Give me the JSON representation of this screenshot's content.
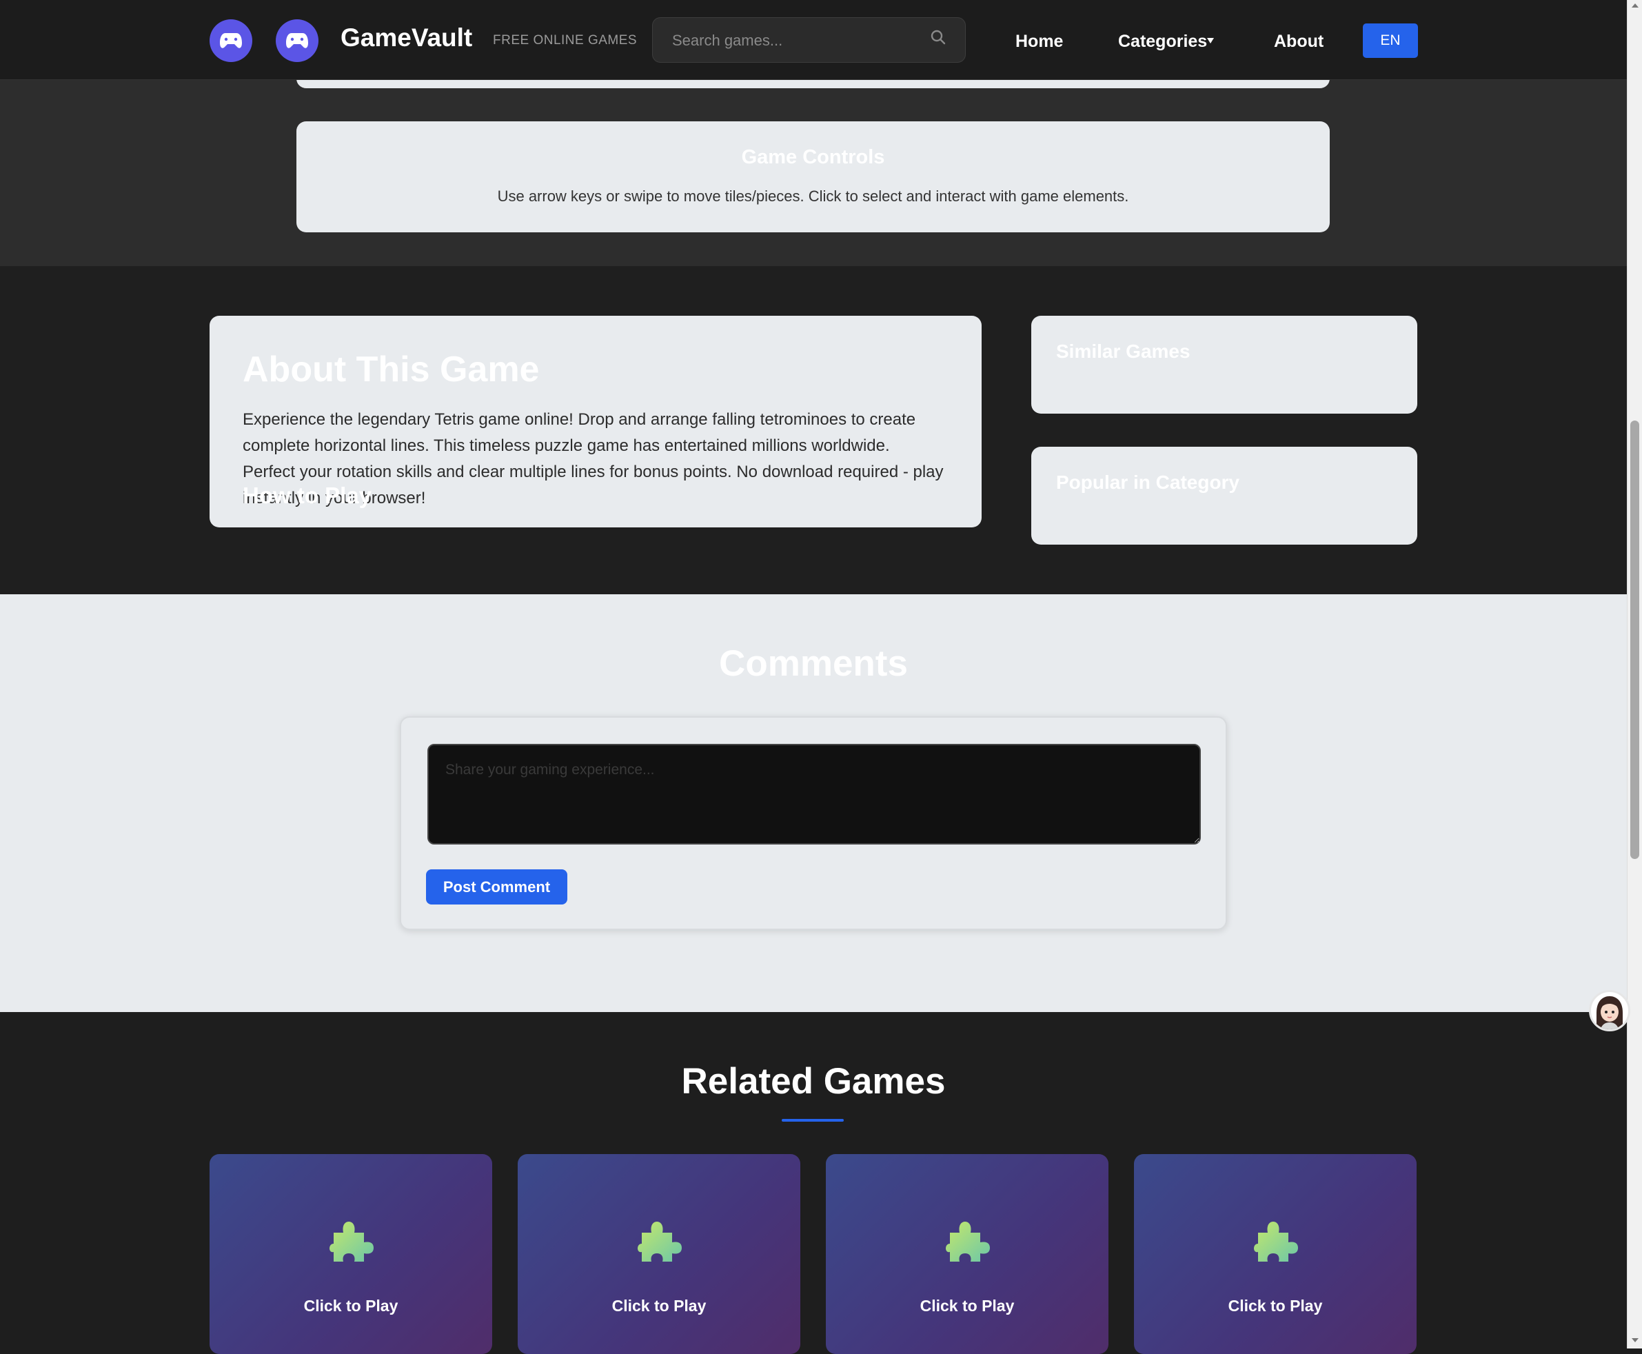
{
  "header": {
    "brand": "GameVault",
    "tagline": "FREE ONLINE GAMES",
    "search_placeholder": "Search games...",
    "nav": {
      "home": "Home",
      "categories": "Categories",
      "about": "About"
    },
    "language": "EN"
  },
  "controls": {
    "title": "Game Controls",
    "text": "Use arrow keys or swipe to move tiles/pieces. Click to select and interact with game elements."
  },
  "about": {
    "title": "About This Game",
    "text": "Experience the legendary Tetris game online! Drop and arrange falling tetrominoes to create complete horizontal lines. This timeless puzzle game has entertained millions worldwide. Perfect your rotation skills and clear multiple lines for bonus points. No download required - play instantly in your browser!",
    "how_to_title": "How to Play"
  },
  "sidebar": {
    "similar_title": "Similar Games",
    "popular_title": "Popular in Category"
  },
  "comments": {
    "title": "Comments",
    "placeholder": "Share your gaming experience...",
    "post_label": "Post Comment"
  },
  "related": {
    "title": "Related Games",
    "games": [
      {
        "label": "Click to Play",
        "icon": "puzzle-piece-icon"
      },
      {
        "label": "Click to Play",
        "icon": "puzzle-piece-icon"
      },
      {
        "label": "Click to Play",
        "icon": "puzzle-piece-icon"
      },
      {
        "label": "Click to Play",
        "icon": "puzzle-piece-icon"
      }
    ]
  },
  "colors": {
    "accent": "#2563eb",
    "logo": "#5b55e6",
    "header_bg": "#1c1c1c",
    "card_bg": "#e8ebee"
  }
}
